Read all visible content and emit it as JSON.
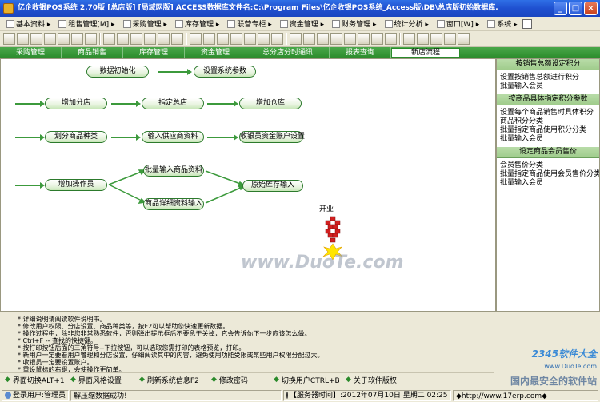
{
  "window": {
    "title": "亿企收银POS系统 2.70版 [总店版] [局域网版] ACCESS数据库文件名:C:\\Program Files\\亿企收银POS系统_Access版\\DB\\总店版初始数据库.MDB...",
    "controls": [
      "_",
      "□",
      "×"
    ]
  },
  "menu": [
    {
      "label": "基本资料 ▸",
      "icon": "book-icon"
    },
    {
      "label": "租售管理[M] ▸",
      "icon": "doc-icon"
    },
    {
      "label": "采购管理 ▸",
      "icon": "cart-icon"
    },
    {
      "label": "库存管理 ▸",
      "icon": "box-icon"
    },
    {
      "label": "联营专柜 ▸",
      "icon": "store-icon"
    },
    {
      "label": "资金管理 ▸",
      "icon": "money-icon"
    },
    {
      "label": "财务管理 ▸",
      "icon": "ledger-icon"
    },
    {
      "label": "统计分析 ▸",
      "icon": "chart-icon"
    },
    {
      "label": "窗口[W] ▸",
      "icon": "window-icon"
    },
    {
      "label": "系统 ▸",
      "icon": "system-icon"
    }
  ],
  "nav_tabs": [
    "采购管理",
    "商品销售",
    "库存管理",
    "资金管理",
    "总分店分时通讯",
    "报表查询",
    "新店流程"
  ],
  "flow": {
    "nodes": {
      "init": "数据初始化",
      "sysparams": "设置系统参数",
      "add_branch": "增加分店",
      "set_head": "指定总店",
      "add_warehouse": "增加仓库",
      "categories": "划分商品种类",
      "suppliers": "输入供应商资料",
      "cashier_accounts": "收银员资金账户设置",
      "add_operator": "增加操作员",
      "batch_products": "批量输入商品资料",
      "product_detail": "商品详细资料输入",
      "opening_stock": "原始库存输入"
    },
    "firework_label": "开业"
  },
  "watermark": "www.DuoTe.com",
  "sidebar": {
    "sections": [
      {
        "title": "按销售总额设定积分",
        "items": [
          "设置按销售总额进行积分",
          "批量输入会员"
        ]
      },
      {
        "title": "按商品具体指定积分参数",
        "items": [
          "设置每个商品销售时具体积分",
          "商品积分分类",
          "批量指定商品使用积分分类",
          "批量输入会员"
        ]
      },
      {
        "title": "设定商品会员售价",
        "items": [
          "会员售价分类",
          "批量指定商品使用会员售价分类",
          "批量输入会员"
        ]
      }
    ]
  },
  "notes": [
    "* 详细说明请阅读软件说明书。",
    "* 修改用户权限、分店设置、商品种类等，按F2可以帮助您快速更新数据。",
    "* 操作过程中，除非您非常熟悉软件，否则弹出提示框后不要急于关掉，它会告诉你下一步应该怎么做。",
    "* Ctrl+F -- 查找的快捷键。",
    "* 按打印按钮后面的三角符号--下拉按钮，可以选取您需打印的表格预览，打印。",
    "* 新用户一定要看用户管理和分店设置，仔细阅读其中的内容，避免使用功能受限或某些用户权限分配过大。",
    "* 收银员一定要设置账户。",
    "* 重设鼠标的右键，会使操作更简单。"
  ],
  "quickbar": [
    {
      "label": "界面切换ALT+1"
    },
    {
      "label": "界面风格设置"
    },
    {
      "label": "刷新系统信息F2"
    },
    {
      "label": "修改密码"
    },
    {
      "label": "切换用户CTRL+B"
    },
    {
      "label": "关于软件版权"
    }
  ],
  "brand": {
    "line1": "2345软件大全",
    "line2": "www.DuoTe.com",
    "line3": "国内最安全的软件站"
  },
  "status": {
    "login": "登录用户:管理员",
    "message": "解压缩数据成功!",
    "server_time": "【服务器时间】:2012年07月10日  星期二  02:25 PM",
    "website": "◆http://www.17erp.com◆"
  },
  "colors": {
    "title_bar": "#1f50d0",
    "nav_green": "#2a8a2a",
    "node_border": "#2c7a2c",
    "arrow": "#3c9a3c",
    "sidebar_header": "#a0cc8c"
  }
}
